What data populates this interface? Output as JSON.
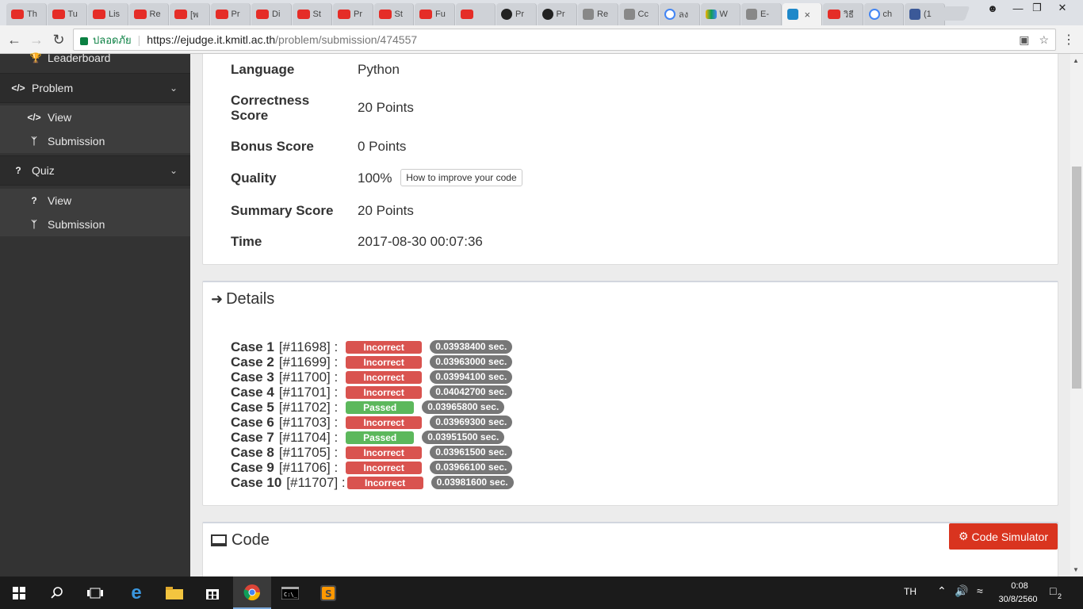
{
  "browser": {
    "tabs": [
      {
        "label": "Th",
        "icon": "youtube-icon"
      },
      {
        "label": "Tu",
        "icon": "youtube-icon"
      },
      {
        "label": "Lis",
        "icon": "youtube-icon"
      },
      {
        "label": "Re",
        "icon": "youtube-icon"
      },
      {
        "label": "[พ",
        "icon": "youtube-icon"
      },
      {
        "label": "Pr",
        "icon": "youtube-icon"
      },
      {
        "label": "Di",
        "icon": "youtube-icon"
      },
      {
        "label": "St",
        "icon": "youtube-icon"
      },
      {
        "label": "Pr",
        "icon": "youtube-icon"
      },
      {
        "label": "St",
        "icon": "youtube-icon"
      },
      {
        "label": "Fu",
        "icon": "youtube-icon"
      },
      {
        "label": "",
        "icon": "youtube-icon"
      },
      {
        "label": "Pr",
        "icon": "github-icon"
      },
      {
        "label": "Pr",
        "icon": "github-icon"
      },
      {
        "label": "Re",
        "icon": "page-icon"
      },
      {
        "label": "Cc",
        "icon": "page-icon"
      },
      {
        "label": "ลง",
        "icon": "google-icon"
      },
      {
        "label": "W",
        "icon": "drive-icon"
      },
      {
        "label": "E-",
        "icon": "page-icon"
      },
      {
        "label": "",
        "icon": "it-icon",
        "active": true
      },
      {
        "label": "วิธี",
        "icon": "youtube-icon"
      },
      {
        "label": "ch",
        "icon": "google-icon"
      },
      {
        "label": "(1",
        "icon": "facebook-icon"
      }
    ],
    "active_tab_close": "×",
    "secure_label": "ปลอดภัย",
    "url_host": "https://ejudge.it.kmitl.ac.th",
    "url_path": "/problem/submission/474557"
  },
  "sidebar": {
    "leaderboard": "Leaderboard",
    "problem": {
      "label": "Problem",
      "view": "View",
      "submission": "Submission"
    },
    "quiz": {
      "label": "Quiz",
      "view": "View",
      "submission": "Submission"
    }
  },
  "info": {
    "language_label": "Language",
    "language_value": "Python",
    "correctness_label": "Correctness Score",
    "correctness_value": "20 Points",
    "bonus_label": "Bonus Score",
    "bonus_value": "0 Points",
    "quality_label": "Quality",
    "quality_value": "100%",
    "improve_button": "How to improve your code",
    "summary_label": "Summary Score",
    "summary_value": "20 Points",
    "time_label": "Time",
    "time_value": "2017-08-30 00:07:36"
  },
  "details": {
    "title": "Details",
    "cases": [
      {
        "name": "Case 1",
        "id": "[#11698] :",
        "status": "Incorrect",
        "time": "0.03938400 sec."
      },
      {
        "name": "Case 2",
        "id": "[#11699] :",
        "status": "Incorrect",
        "time": "0.03963000 sec."
      },
      {
        "name": "Case 3",
        "id": "[#11700] :",
        "status": "Incorrect",
        "time": "0.03994100 sec."
      },
      {
        "name": "Case 4",
        "id": "[#11701] :",
        "status": "Incorrect",
        "time": "0.04042700 sec."
      },
      {
        "name": "Case 5",
        "id": "[#11702] :",
        "status": "Passed",
        "time": "0.03965800 sec."
      },
      {
        "name": "Case 6",
        "id": "[#11703] :",
        "status": "Incorrect",
        "time": "0.03969300 sec."
      },
      {
        "name": "Case 7",
        "id": "[#11704] :",
        "status": "Passed",
        "time": "0.03951500 sec."
      },
      {
        "name": "Case 8",
        "id": "[#11705] :",
        "status": "Incorrect",
        "time": "0.03961500 sec."
      },
      {
        "name": "Case 9",
        "id": "[#11706] :",
        "status": "Incorrect",
        "time": "0.03966100 sec."
      },
      {
        "name": "Case 10",
        "id": "[#11707] :",
        "status": "Incorrect",
        "time": "0.03981600 sec."
      }
    ]
  },
  "code": {
    "title": "Code",
    "simulator_button": "Code Simulator"
  },
  "taskbar": {
    "language": "TH",
    "clock_time": "0:08",
    "clock_date": "30/8/2560",
    "notification_count": "2"
  },
  "colors": {
    "incorrect": "#d9534f",
    "passed": "#5cb85c",
    "time_badge": "#777777",
    "sidebar_bg": "#333333",
    "code_simulator": "#d9341f"
  }
}
